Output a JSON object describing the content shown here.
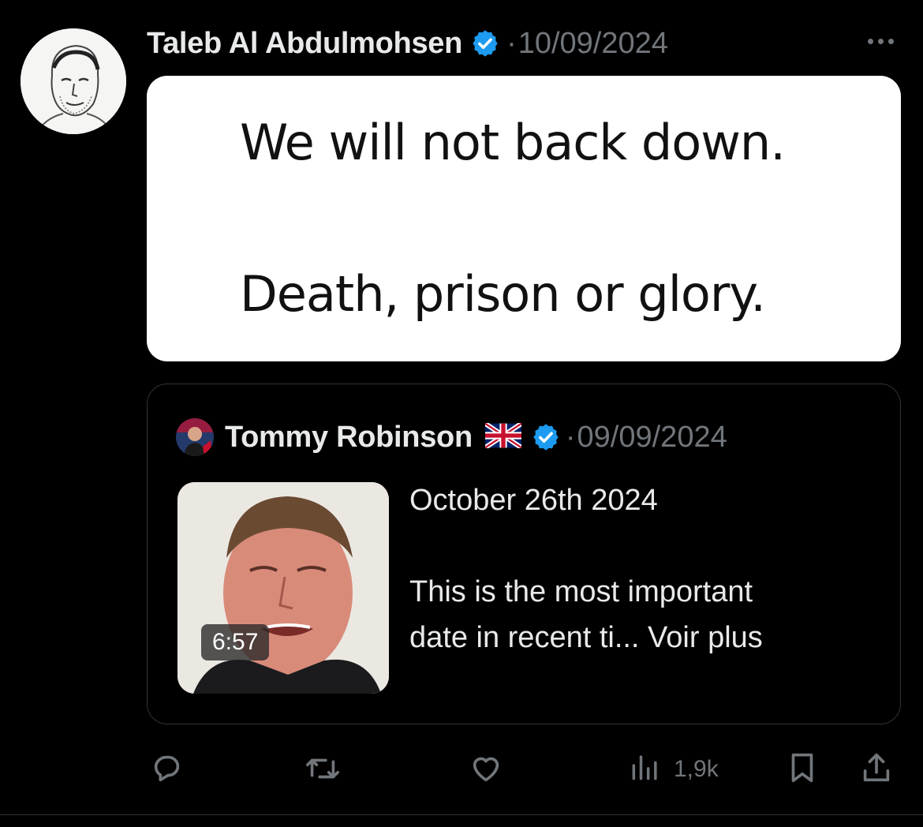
{
  "tweet": {
    "author_name": "Taleb Al Abdulmohsen",
    "date": "10/09/2024",
    "dot": "·",
    "image_text": {
      "line1": "We will not back down.",
      "line2": "Death, prison or glory."
    }
  },
  "quoted": {
    "author_name": "Tommy Robinson",
    "flag": "🇬🇧",
    "date": "09/09/2024",
    "dot": "·",
    "video_duration": "6:57",
    "text_line1": "October 26th 2024",
    "text_line2": "This is the most important",
    "text_line3": "date in recent ti... Voir plus"
  },
  "actions": {
    "views": "1,9k",
    "icons": [
      "reply-icon",
      "retweet-icon",
      "like-icon",
      "views-icon",
      "bookmark-icon",
      "share-icon"
    ]
  },
  "colors": {
    "background": "#000000",
    "text": "#e7e9ea",
    "muted": "#71767b",
    "verified": "#1d9bf0",
    "border": "#2f3336"
  }
}
